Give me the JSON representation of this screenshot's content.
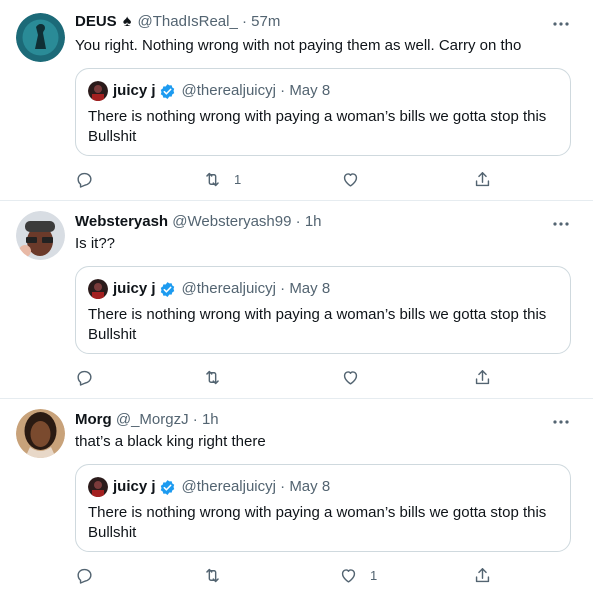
{
  "tweets": [
    {
      "name": "DEUS",
      "badge_icon": "spade-icon",
      "handle": "@ThadIsReal_",
      "time": "57m",
      "text": "You right. Nothing wrong with not paying them as well. Carry on tho",
      "quote": {
        "name": "juicy j",
        "handle": "@therealjuicyj",
        "date": "May 8",
        "text": "There is nothing wrong with paying a woman’s bills we gotta stop this Bullshit"
      },
      "actions": {
        "reply": "",
        "retweet": "1",
        "like": ""
      }
    },
    {
      "name": "Websteryash",
      "handle": "@Websteryash99",
      "time": "1h",
      "text": "Is it??",
      "quote": {
        "name": "juicy j",
        "handle": "@therealjuicyj",
        "date": "May 8",
        "text": "There is nothing wrong with paying a woman’s bills we gotta stop this Bullshit"
      },
      "actions": {
        "reply": "",
        "retweet": "",
        "like": ""
      }
    },
    {
      "name": "Morg",
      "handle": "@_MorgzJ",
      "time": "1h",
      "text": "that’s a black king right there",
      "quote": {
        "name": "juicy j",
        "handle": "@therealjuicyj",
        "date": "May 8",
        "text": "There is nothing wrong with paying a woman’s bills we gotta stop this Bullshit"
      },
      "actions": {
        "reply": "",
        "retweet": "",
        "like": "1"
      }
    }
  ],
  "colors": {
    "meta": "#536471",
    "verified": "#1d9bf0",
    "border": "#cfd9de"
  }
}
